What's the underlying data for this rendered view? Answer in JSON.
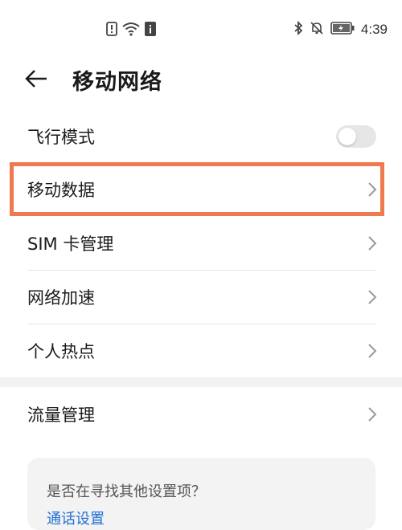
{
  "status_bar": {
    "time": "4:39",
    "left_icons": [
      "alert-sim-icon",
      "wifi-icon",
      "info-icon"
    ],
    "right_icons": [
      "bluetooth-icon",
      "mute-icon",
      "battery-icon"
    ]
  },
  "header": {
    "title": "移动网络"
  },
  "rows": {
    "airplane": {
      "label": "飞行模式",
      "toggle_on": false
    },
    "mobile_data": {
      "label": "移动数据"
    },
    "sim": {
      "label": "SIM 卡管理"
    },
    "accel": {
      "label": "网络加速"
    },
    "hotspot": {
      "label": "个人热点"
    },
    "traffic": {
      "label": "流量管理"
    }
  },
  "suggestion": {
    "question": "是否在寻找其他设置项？",
    "link": "通话设置"
  },
  "colors": {
    "highlight": "#f07a4f",
    "link": "#1f6fd6"
  }
}
